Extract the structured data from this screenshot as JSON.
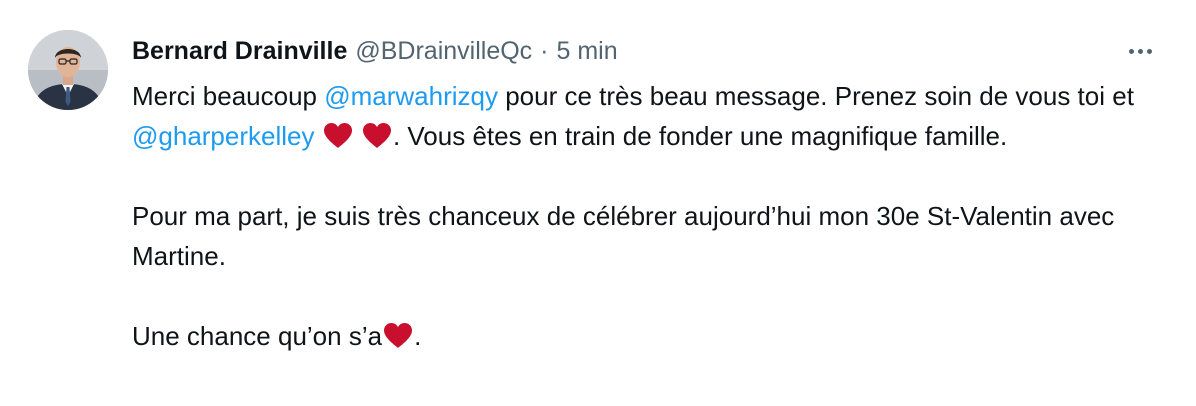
{
  "tweet": {
    "author": {
      "display_name": "Bernard Drainville",
      "handle": "@BDrainvilleQc",
      "separator": "·",
      "time": "5 min"
    },
    "more_menu_icon": "ellipsis-horizontal-icon",
    "paragraph1": {
      "text1": "Merci beaucoup ",
      "mention1": "@marwahrizqy",
      "text2": " pour ce très beau message. Prenez soin de vous toi et ",
      "mention2": "@gharperkelley",
      "heart_icon": "red-heart-emoji-icon",
      "text3": ". Vous êtes en train de fonder une magnifique famille."
    },
    "paragraph2": {
      "text": "Pour ma part, je suis très chanceux de célébrer aujourd’hui mon 30e St-Valentin avec Martine."
    },
    "paragraph3": {
      "text1": "Une chance qu’on s’a",
      "heart_icon": "red-heart-emoji-icon",
      "text2": "."
    },
    "colors": {
      "text": "#0f1419",
      "secondary": "#536471",
      "mention": "#1d9bf0",
      "heart": "#e0243b"
    }
  }
}
